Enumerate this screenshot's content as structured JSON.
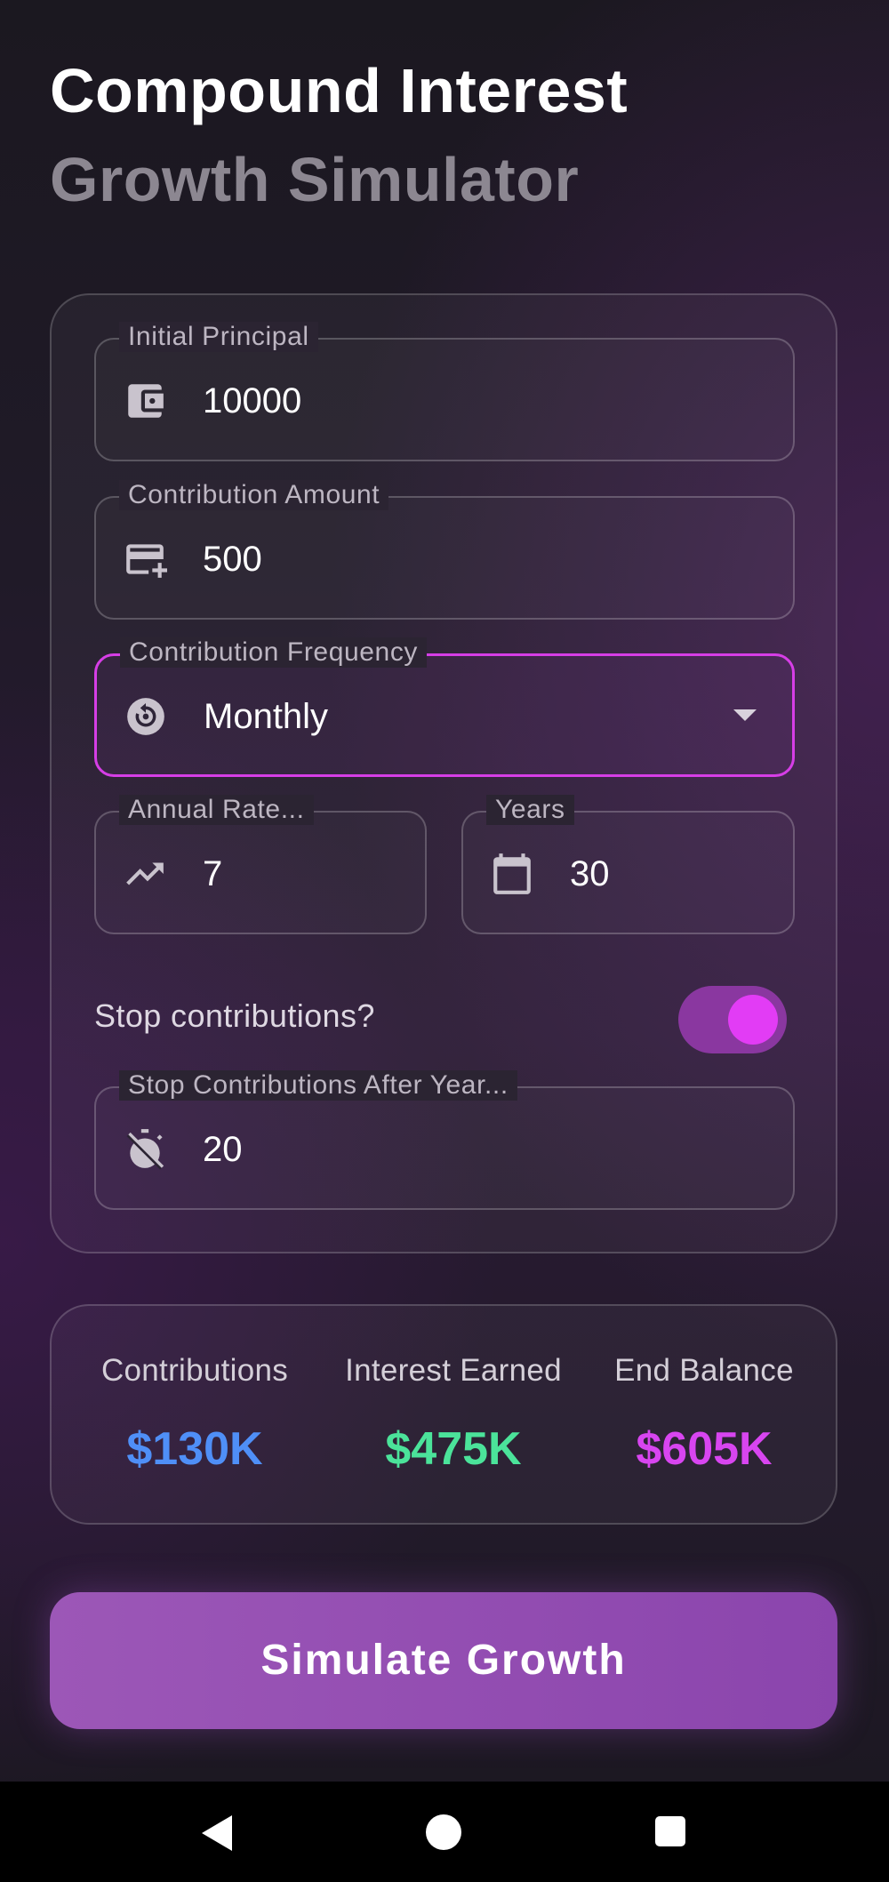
{
  "header": {
    "title_line1": "Compound Interest",
    "title_line2": "Growth Simulator"
  },
  "form": {
    "initial_principal": {
      "label": "Initial Principal",
      "value": "10000",
      "icon": "wallet-icon"
    },
    "contribution_amount": {
      "label": "Contribution Amount",
      "value": "500",
      "icon": "add-card-icon"
    },
    "contribution_frequency": {
      "label": "Contribution Frequency",
      "value": "Monthly",
      "icon": "history-icon"
    },
    "annual_rate": {
      "label": "Annual Rate...",
      "value": "7",
      "icon": "trending-up-icon"
    },
    "years": {
      "label": "Years",
      "value": "30",
      "icon": "calendar-icon"
    },
    "stop_toggle": {
      "label": "Stop contributions?",
      "on": true
    },
    "stop_after_year": {
      "label": "Stop Contributions After Year...",
      "value": "20",
      "icon": "timer-off-icon"
    }
  },
  "summary": {
    "contributions": {
      "label": "Contributions",
      "value": "$130K",
      "color": "#4f8ff7"
    },
    "interest_earned": {
      "label": "Interest Earned",
      "value": "$475K",
      "color": "#4be39a"
    },
    "end_balance": {
      "label": "End Balance",
      "value": "$605K",
      "color": "#d845f0"
    }
  },
  "actions": {
    "simulate_label": "Simulate Growth"
  },
  "colors": {
    "accent": "#d63ee6",
    "button": "#9352b3"
  }
}
